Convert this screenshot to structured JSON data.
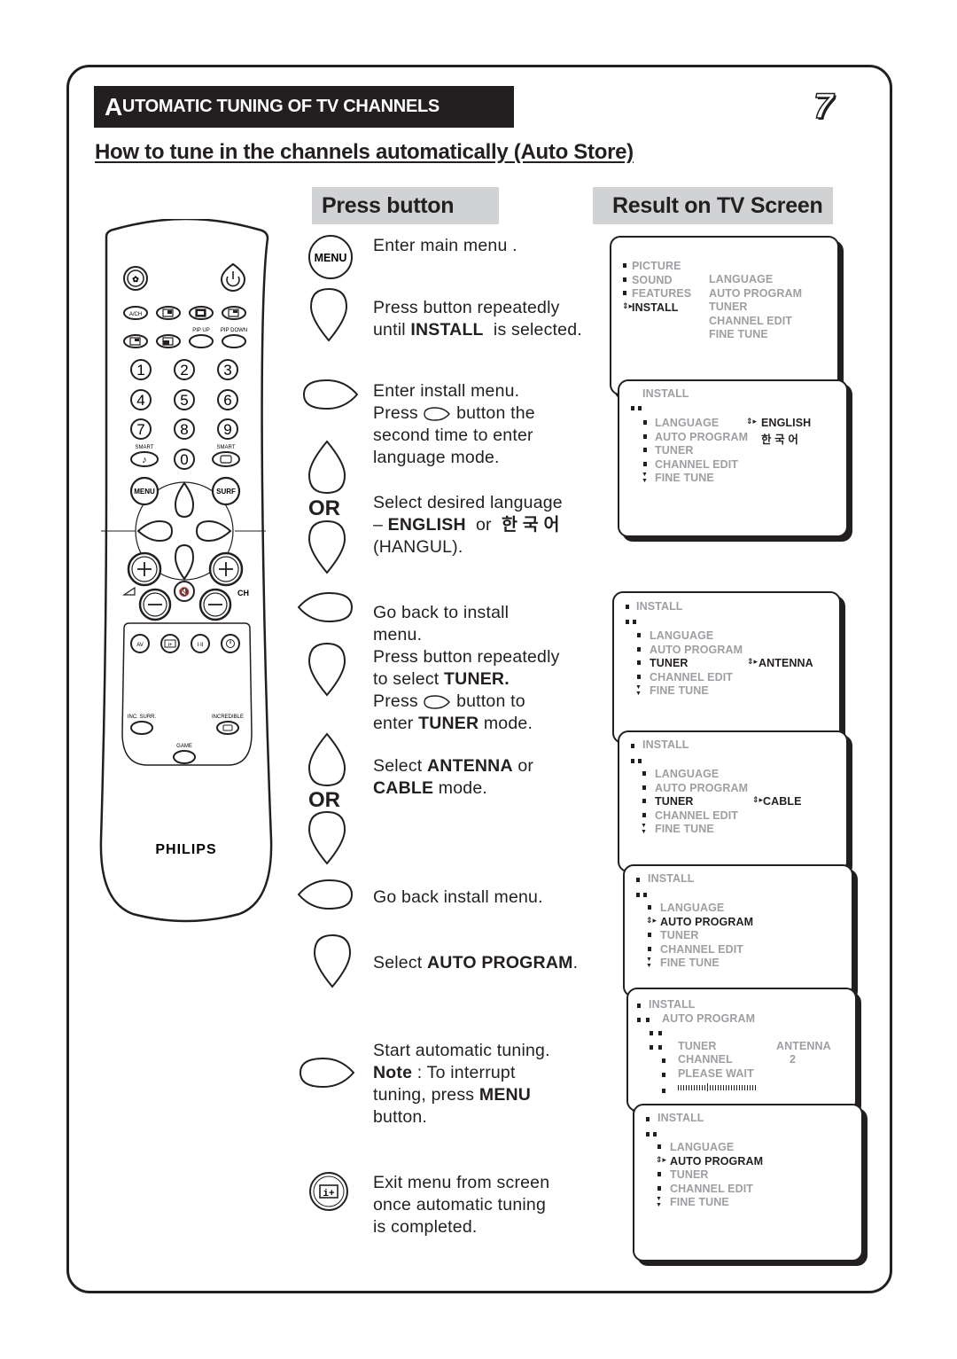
{
  "header": {
    "section_title_first": "A",
    "section_title_rest": "UTOMATIC TUNING OF TV CHANNELS",
    "page_number": "7",
    "subtitle": "How to tune in the channels automatically (Auto Store)",
    "col_press": "Press button",
    "col_result": "Result on TV Screen"
  },
  "remote": {
    "brand": "PHILIPS",
    "labels": {
      "ach": "A/CH",
      "pip_up": "PIP UP",
      "pip_down": "PIP DOWN",
      "smart_left": "SMART",
      "smart_right": "SMART",
      "menu": "MENU",
      "surf": "SURF",
      "ch": "CH",
      "av": "AV",
      "stereo": "I·II",
      "inc_surr": "INC. SURR.",
      "incredible": "INCREDIBLE",
      "game": "GAME"
    },
    "digits": [
      "1",
      "2",
      "3",
      "4",
      "5",
      "6",
      "7",
      "8",
      "9",
      "0"
    ]
  },
  "steps": {
    "or_label": "OR",
    "menu_button_label": "MENU",
    "s1": {
      "text": "Enter main menu ."
    },
    "s2": {
      "pre": "Press button repeatedly",
      "line2_pre": "until ",
      "bold": "INSTALL",
      "post": "  is selected."
    },
    "s3": {
      "l1": "Enter install menu.",
      "l2_pre": "Press ",
      "l2_post": " button the",
      "l3": "second time to enter",
      "l4": "language mode."
    },
    "s4": {
      "l1": "Select desired language",
      "l2_pre": "– ",
      "l2_bold": "ENGLISH",
      "l2_mid": "  or  ",
      "l2_korean": "한 국 어",
      "l3": "(HANGUL)."
    },
    "s5": {
      "l1": "Go back to install",
      "l2": "menu.",
      "l3": "Press button repeatedly",
      "l4_pre": "to select ",
      "l4_bold": "TUNER.",
      "l5_pre": "Press ",
      "l5_post": " button to",
      "l6_pre": "enter ",
      "l6_bold": "TUNER",
      "l6_post": " mode."
    },
    "s6": {
      "l1_pre": "Select ",
      "l1_bold": "ANTENNA",
      "l1_post": " or",
      "l2_bold": "CABLE",
      "l2_post": " mode."
    },
    "s7": {
      "text": "Go back install menu."
    },
    "s8": {
      "pre": "Select ",
      "bold": "AUTO PROGRAM",
      "post": "."
    },
    "s9": {
      "l1": "Start automatic tuning.",
      "l2_bold": "Note",
      "l2_post": " : To interrupt",
      "l3_pre": "tuning, press ",
      "l3_bold": "MENU",
      "l4": "button."
    },
    "s10": {
      "l1": "Exit menu from screen",
      "l2": "once automatic tuning",
      "l3": "is completed."
    }
  },
  "screens": {
    "main_menu": {
      "left": [
        "PICTURE",
        "SOUND",
        "FEATURES",
        "INSTALL"
      ],
      "selected": "INSTALL",
      "right": [
        "LANGUAGE",
        "AUTO PROGRAM",
        "TUNER",
        "CHANNEL EDIT",
        "FINE TUNE"
      ]
    },
    "install_items": [
      "LANGUAGE",
      "AUTO PROGRAM",
      "TUNER",
      "CHANNEL EDIT",
      "FINE TUNE"
    ],
    "install_title": "INSTALL",
    "language": {
      "selected_value": "ENGLISH",
      "alt_value": "한 국 어"
    },
    "tuner_antenna": {
      "value": "ANTENNA"
    },
    "tuner_cable": {
      "value": "CABLE"
    },
    "auto_program": {
      "title": "INSTALL",
      "subtitle": "AUTO PROGRAM",
      "tuner_label": "TUNER",
      "tuner_value": "ANTENNA",
      "channel_label": "CHANNEL",
      "channel_value": "2",
      "status": "PLEASE WAIT",
      "progress": 0.35
    }
  }
}
